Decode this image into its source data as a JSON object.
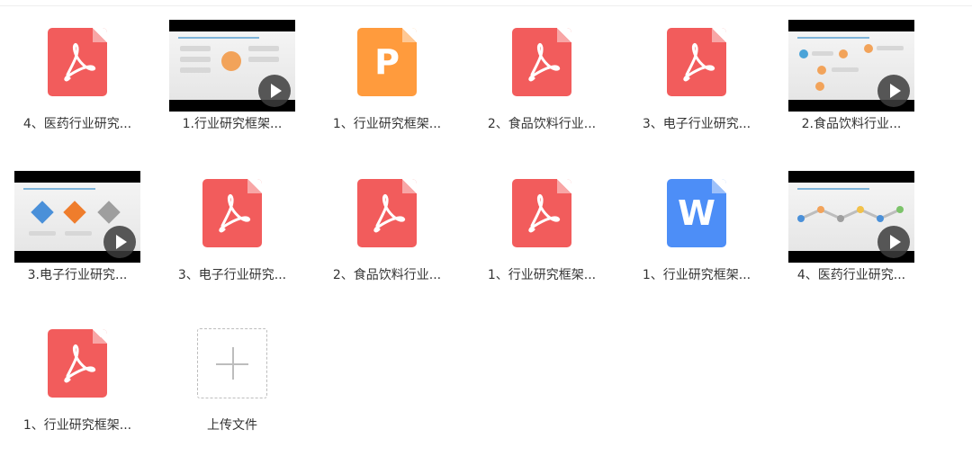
{
  "files": [
    {
      "name": "4、医药行业研究...",
      "type": "pdf",
      "icon": "pdf-icon"
    },
    {
      "name": "1.行业研究框架...",
      "type": "video",
      "icon": "video-thumbnail"
    },
    {
      "name": "1、行业研究框架...",
      "type": "ppt",
      "icon": "ppt-icon",
      "glyph": "P"
    },
    {
      "name": "2、食品饮料行业...",
      "type": "pdf",
      "icon": "pdf-icon"
    },
    {
      "name": "3、电子行业研究...",
      "type": "pdf",
      "icon": "pdf-icon"
    },
    {
      "name": "2.食品饮料行业...",
      "type": "video",
      "icon": "video-thumbnail"
    },
    {
      "name": "3.电子行业研究...",
      "type": "video",
      "icon": "video-thumbnail"
    },
    {
      "name": "3、电子行业研究...",
      "type": "pdf",
      "icon": "pdf-icon"
    },
    {
      "name": "2、食品饮料行业...",
      "type": "pdf",
      "icon": "pdf-icon"
    },
    {
      "name": "1、行业研究框架...",
      "type": "pdf",
      "icon": "pdf-icon"
    },
    {
      "name": "1、行业研究框架...",
      "type": "word",
      "icon": "word-icon",
      "glyph": "W"
    },
    {
      "name": "4、医药行业研究...",
      "type": "video",
      "icon": "video-thumbnail"
    },
    {
      "name": "1、行业研究框架...",
      "type": "pdf",
      "icon": "pdf-icon"
    }
  ],
  "upload": {
    "label": "上传文件",
    "icon": "plus-icon"
  },
  "colors": {
    "pdf": "#f25c5c",
    "ppt": "#ff9b3d",
    "word": "#4d8ef7",
    "text": "#333333"
  }
}
